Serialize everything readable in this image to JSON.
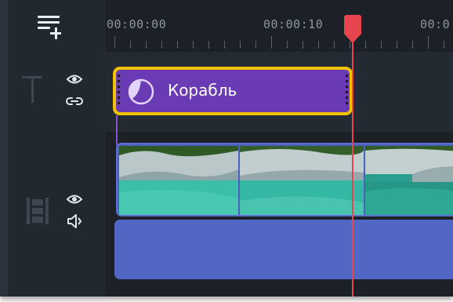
{
  "toolbar": {
    "add_track_icon": "add-track-icon"
  },
  "ruler": {
    "timecodes": [
      "00:00:00",
      "00:00:10",
      "00:0"
    ]
  },
  "tracks": {
    "title_track": {
      "clip_label": "Корабль",
      "clip_icon": "sticker-icon",
      "controls": [
        "eye-icon",
        "link-icon"
      ]
    },
    "video_track": {
      "controls": [
        "eye-icon",
        "speaker-icon"
      ]
    }
  },
  "colors": {
    "background": "#1c2128",
    "title_clip": "#6a3bb4",
    "title_clip_border": "#f2c200",
    "video_clip": "#4a5fc0",
    "audio_clip": "#5266c4",
    "playhead": "#e8464f"
  }
}
